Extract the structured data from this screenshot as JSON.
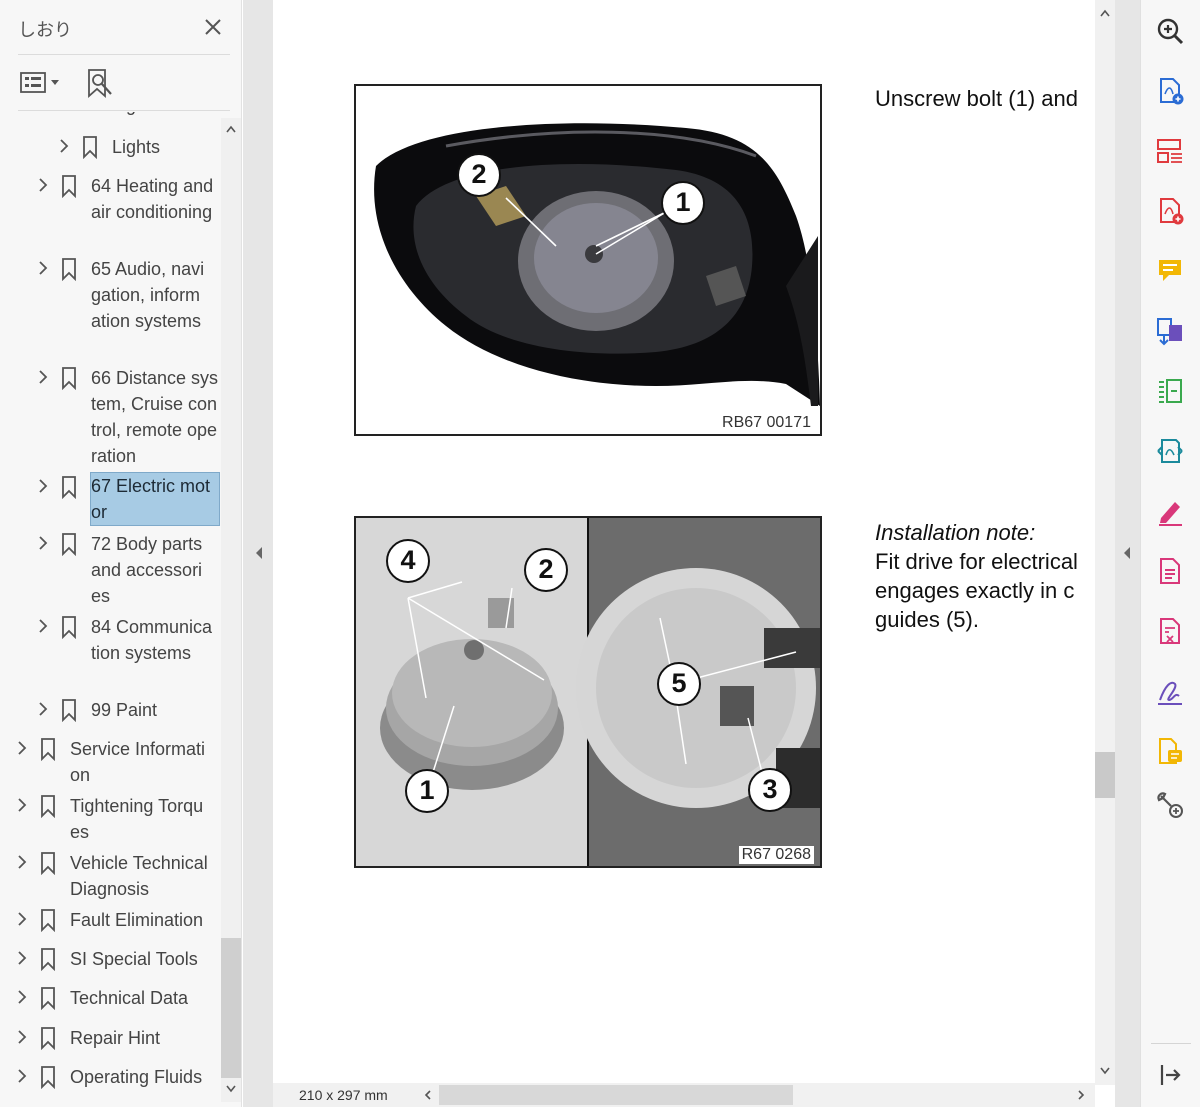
{
  "bookmarks_panel": {
    "title": "しおり",
    "options_button": "options-menu",
    "items": [
      {
        "label": "Lights",
        "level": 2
      },
      {
        "label": "64 Heating and air conditioning",
        "level": 1
      },
      {
        "label": "65 Audio, navigation, information systems",
        "level": 1
      },
      {
        "label": "66 Distance system, Cruise control, remote operation",
        "level": 1
      },
      {
        "label": "67 Electric motor",
        "level": 1,
        "selected": true
      },
      {
        "label": "72 Body parts and accessories",
        "level": 1
      },
      {
        "label": "84 Communication systems",
        "level": 1
      },
      {
        "label": "99 Paint",
        "level": 1
      },
      {
        "label": "Service Information",
        "level": 0
      },
      {
        "label": "Tightening Torques",
        "level": 0
      },
      {
        "label": "Vehicle Technical Diagnosis",
        "level": 0
      },
      {
        "label": "Fault Elimination",
        "level": 0
      },
      {
        "label": "SI Special Tools",
        "level": 0
      },
      {
        "label": "Technical Data",
        "level": 0
      },
      {
        "label": "Repair Hint",
        "level": 0
      },
      {
        "label": "Operating Fluids",
        "level": 0
      }
    ]
  },
  "document": {
    "figure1": {
      "caption": "RB67 00171",
      "callouts": [
        "2",
        "1"
      ]
    },
    "figure2": {
      "caption": "R67 0268",
      "callouts": [
        "4",
        "2",
        "1",
        "5",
        "3"
      ]
    },
    "text1": "Unscrew bolt (1) and",
    "note_title": "Installation note:",
    "note_lines": [
      "Fit drive for electrical",
      "engages exactly in c",
      "guides (5)."
    ],
    "page_size": "210 x 297 mm"
  },
  "tools": [
    "zoom-icon",
    "create-pdf-icon",
    "organize-pages-icon",
    "add-pdf-icon",
    "comment-icon",
    "export-pdf-icon",
    "compress-icon",
    "convert-icon",
    "fill-sign-icon",
    "pdf-file-icon",
    "edit-pdf-icon",
    "signature-icon",
    "share-icon",
    "more-tools-icon",
    "collapse-panel-icon"
  ],
  "colors": {
    "selection": "#a7cbe4",
    "tool_blue": "#2b6cd4",
    "tool_red": "#e03a3e",
    "tool_yellow": "#f2b705",
    "tool_green": "#3aa94e",
    "tool_teal": "#1b8a9c",
    "tool_purple": "#6b4fbb",
    "tool_pink": "#d9387a"
  }
}
